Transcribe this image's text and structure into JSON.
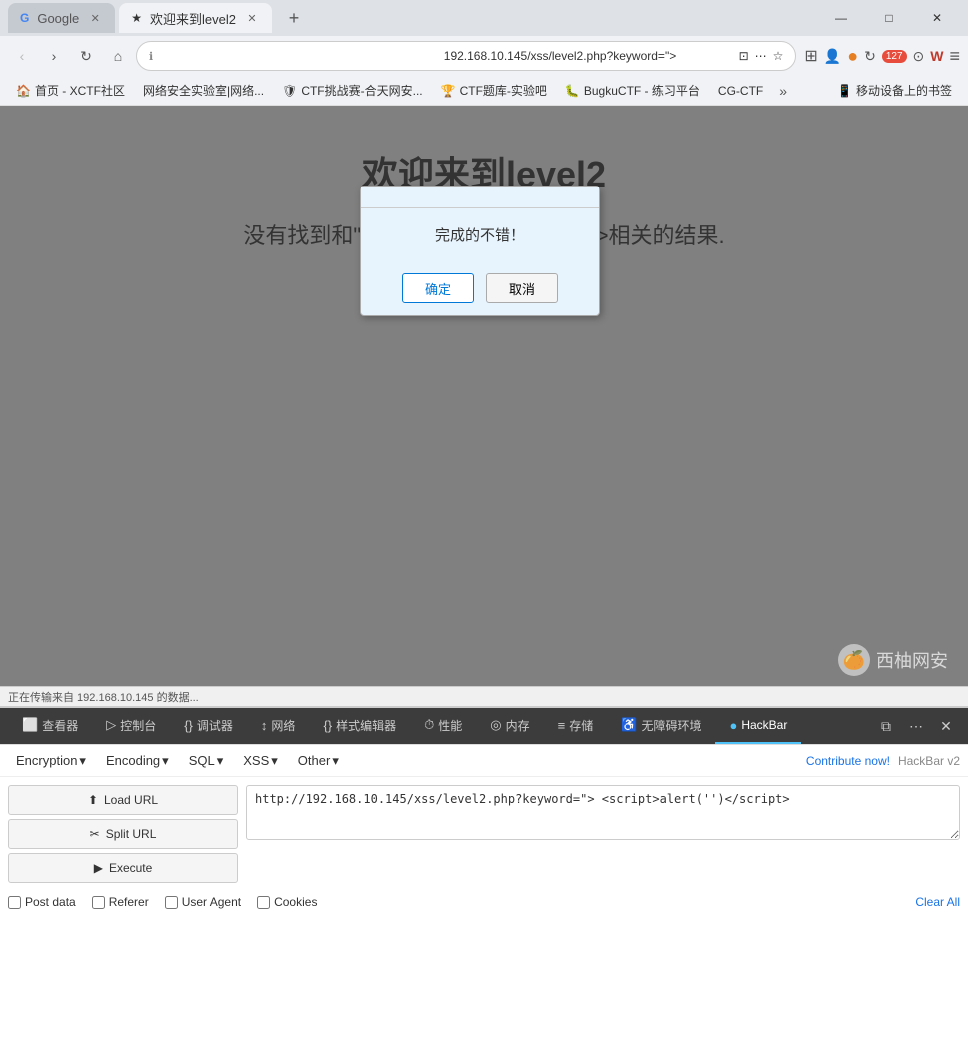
{
  "browser": {
    "tabs": [
      {
        "id": "google",
        "label": "Google",
        "favicon": "G",
        "active": false
      },
      {
        "id": "level2",
        "label": "欢迎来到level2",
        "favicon": "★",
        "active": true
      }
    ],
    "new_tab_label": "+",
    "win_controls": [
      "—",
      "□",
      "✕"
    ],
    "address": {
      "url": "192.168.10.145/xss/level2.php?keyword=\">",
      "secure_icon": "🔒"
    },
    "bookmarks": [
      {
        "label": "首页 - XCTF社区"
      },
      {
        "label": "网络安全实验室|网络..."
      },
      {
        "label": "CTF挑战赛-合天网安..."
      },
      {
        "label": "CTF题库-实验吧"
      },
      {
        "label": "BugkuCTF - 练习平台"
      },
      {
        "label": "CG-CTF"
      },
      {
        "label": "»"
      },
      {
        "label": "移动设备上的书签"
      }
    ]
  },
  "page": {
    "title": "欢迎来到level2",
    "subtitle": "没有找到和\"> <script>alert('')<\\/script>相关的结果.",
    "background": "#808080"
  },
  "dialog": {
    "message": "完成的不错！",
    "confirm_label": "确定",
    "cancel_label": "取消"
  },
  "status_bar": {
    "text": "正在传输来自 192.168.10.145 的数据..."
  },
  "devtools": {
    "tabs": [
      {
        "id": "inspector",
        "label": "查看器",
        "icon": "⬜"
      },
      {
        "id": "console",
        "label": "控制台",
        "icon": ">_"
      },
      {
        "id": "debugger",
        "label": "调试器",
        "icon": "{}"
      },
      {
        "id": "network",
        "label": "网络",
        "icon": "↕"
      },
      {
        "id": "style",
        "label": "样式编辑器",
        "icon": "{}"
      },
      {
        "id": "performance",
        "label": "性能",
        "icon": "⏱"
      },
      {
        "id": "memory",
        "label": "内存",
        "icon": "◎"
      },
      {
        "id": "storage",
        "label": "存储",
        "icon": "≡"
      },
      {
        "id": "accessibility",
        "label": "无障碍环境",
        "icon": "♿"
      },
      {
        "id": "hackbar",
        "label": "HackBar",
        "icon": "●",
        "active": true
      }
    ],
    "action_buttons": [
      "⧉",
      "⋯",
      "✕"
    ]
  },
  "hackbar": {
    "version_text": "HackBar v2",
    "contribute_text": "Contribute now!",
    "menu": [
      {
        "label": "Encryption",
        "has_arrow": true
      },
      {
        "label": "Encoding",
        "has_arrow": true
      },
      {
        "label": "SQL",
        "has_arrow": true
      },
      {
        "label": "XSS",
        "has_arrow": true
      },
      {
        "label": "Other",
        "has_arrow": true
      }
    ],
    "buttons": [
      {
        "id": "load-url",
        "label": "Load URL",
        "icon": "⬆"
      },
      {
        "id": "split-url",
        "label": "Split URL",
        "icon": "✂"
      },
      {
        "id": "execute",
        "label": "Execute",
        "icon": "▶"
      }
    ],
    "url_value": "http://192.168.10.145/xss/level2.php?keyword=\"> <script>alert('')<\\/script>",
    "checkboxes": [
      {
        "label": "Post data",
        "checked": false
      },
      {
        "label": "Referer",
        "checked": false
      },
      {
        "label": "User Agent",
        "checked": false
      },
      {
        "label": "Cookies",
        "checked": false
      }
    ],
    "clear_all_label": "Clear All"
  },
  "watermark": {
    "text": "西柚网安"
  }
}
